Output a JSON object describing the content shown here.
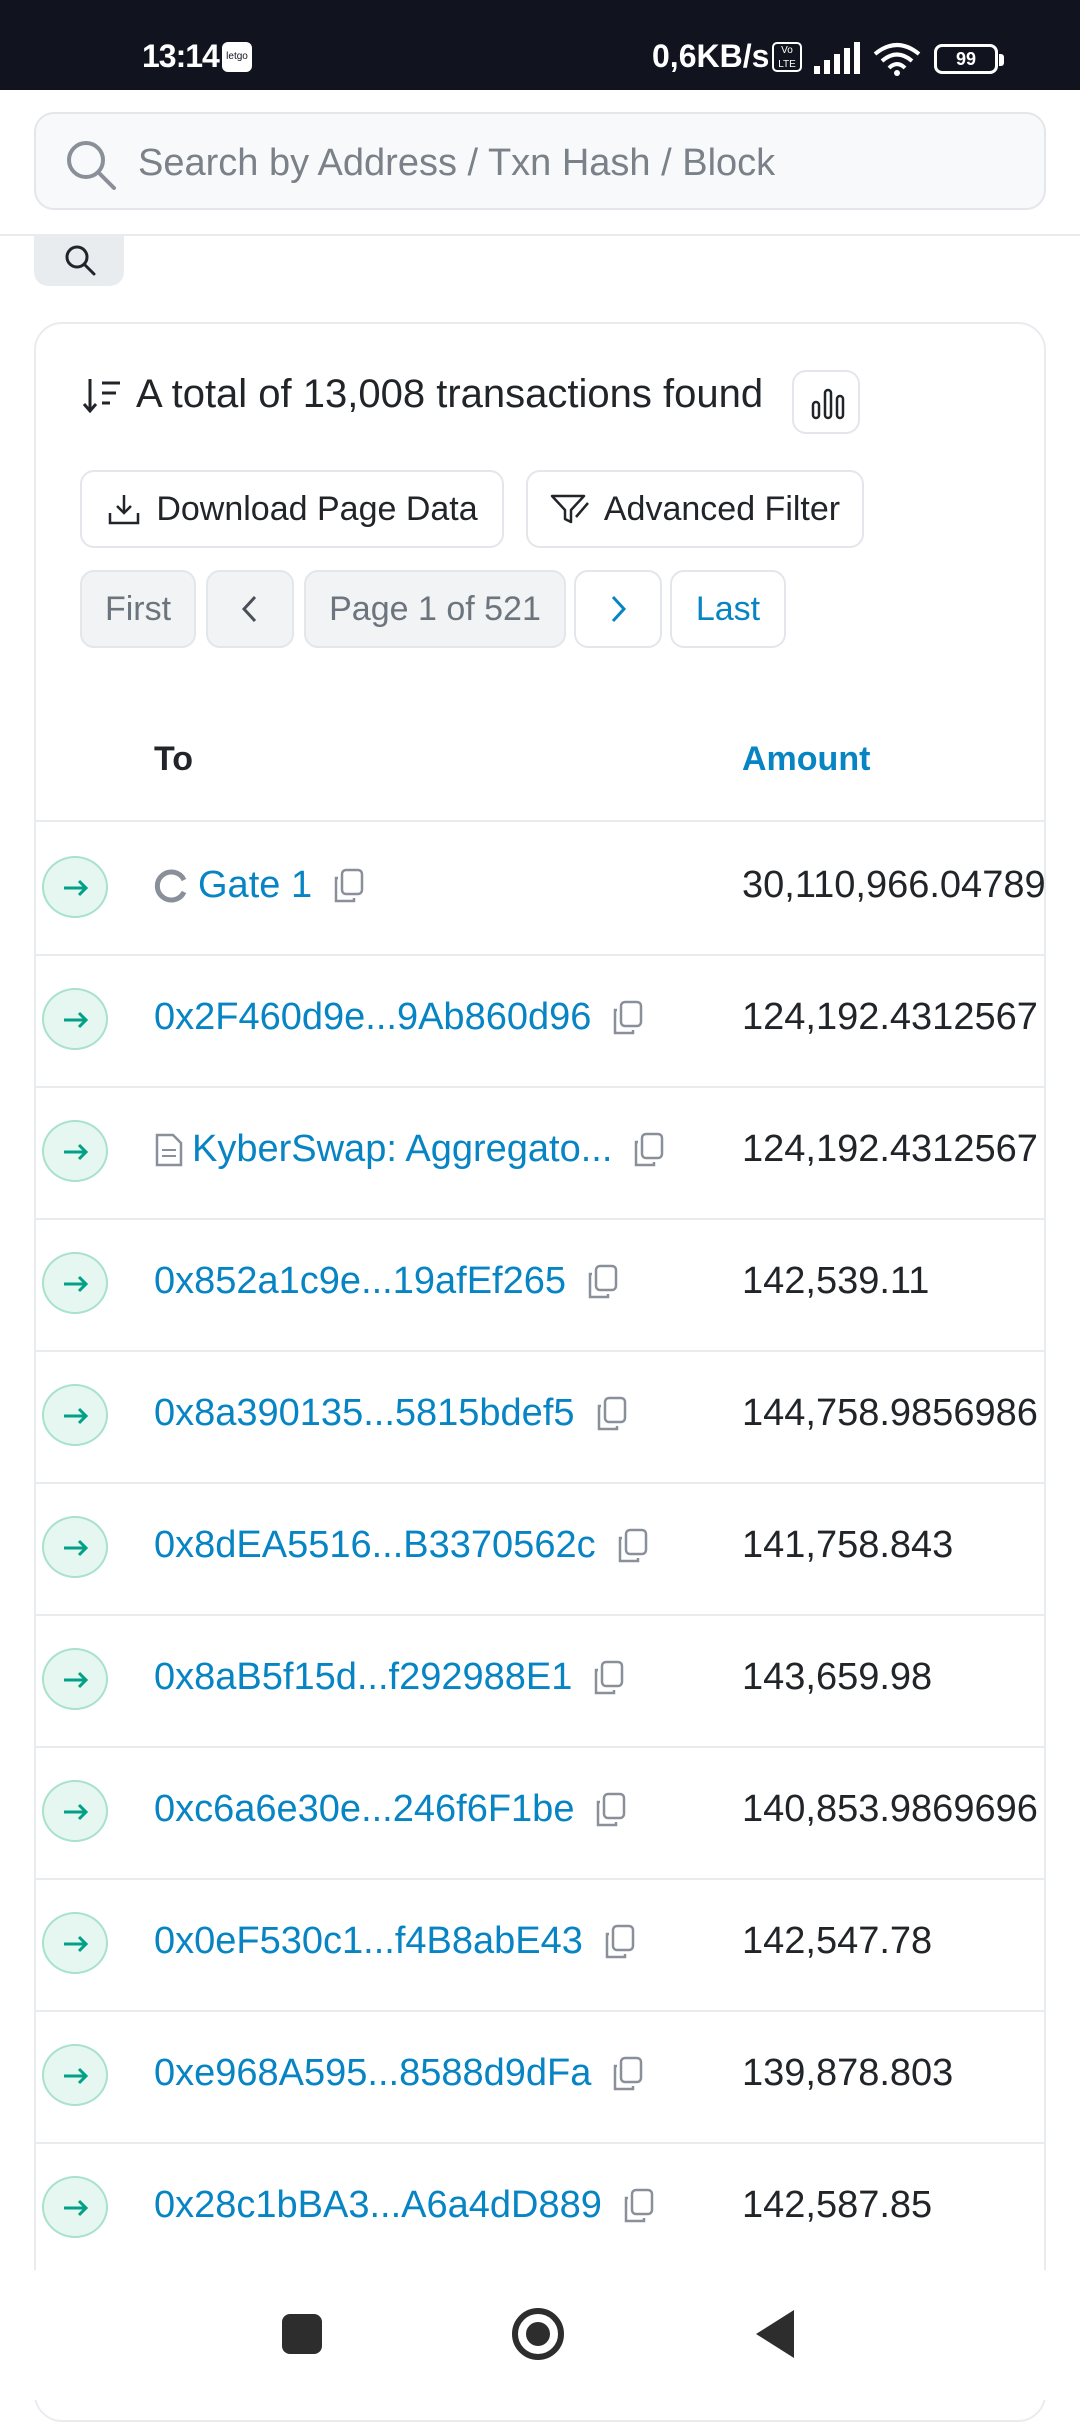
{
  "status_bar": {
    "time": "13:14",
    "app_badge": "letgo",
    "network_speed": "0,6KB/s",
    "volte": "Vo LTE",
    "battery": "99"
  },
  "search": {
    "placeholder": "Search by Address / Txn Hash / Block"
  },
  "summary": {
    "text": "A total of 13,008 transactions found"
  },
  "actions": {
    "download_label": "Download Page Data",
    "filter_label": "Advanced Filter"
  },
  "pagination": {
    "first": "First",
    "info": "Page 1 of 521",
    "last": "Last"
  },
  "table": {
    "columns": {
      "to": "To",
      "amount": "Amount"
    },
    "rows": [
      {
        "to": "Gate 1",
        "to_icon": "gate-logo-icon",
        "amount": "30,110,966.04789"
      },
      {
        "to": "0x2F460d9e...9Ab860d96",
        "amount": "124,192.4312567"
      },
      {
        "to": "KyberSwap: Aggregato...",
        "to_icon": "contract-icon",
        "amount": "124,192.4312567"
      },
      {
        "to": "0x852a1c9e...19afEf265",
        "amount": "142,539.11"
      },
      {
        "to": "0x8a390135...5815bdef5",
        "amount": "144,758.9856986"
      },
      {
        "to": "0x8dEA5516...B3370562c",
        "amount": "141,758.843"
      },
      {
        "to": "0x8aB5f15d...f292988E1",
        "amount": "143,659.98"
      },
      {
        "to": "0xc6a6e30e...246f6F1be",
        "amount": "140,853.9869696"
      },
      {
        "to": "0x0eF530c1...f4B8abE43",
        "amount": "142,547.78"
      },
      {
        "to": "0xe968A595...8588d9dFa",
        "amount": "139,878.803"
      },
      {
        "to": "0x28c1bBA3...A6a4dD889",
        "amount": "142,587.85"
      }
    ]
  },
  "colors": {
    "link": "#0784c3",
    "direction_bg": "#e6f7f1",
    "direction_fg": "#00a186"
  }
}
